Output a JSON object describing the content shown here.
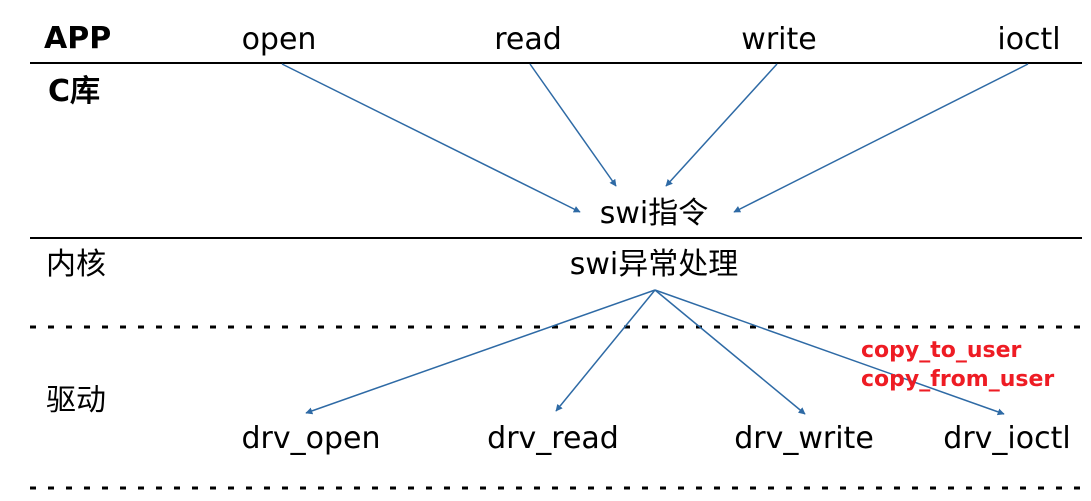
{
  "layers": {
    "app": "APP",
    "c_lib": "C库",
    "kernel": "内核",
    "driver": "驱动"
  },
  "app_calls": [
    "open",
    "read",
    "write",
    "ioctl"
  ],
  "swi_instruction": "swi指令",
  "swi_handler": "swi异常处理",
  "drivers": [
    "drv_open",
    "drv_read",
    "drv_write",
    "drv_ioctl"
  ],
  "copy_notes": [
    "copy_to_user",
    "copy_from_user"
  ],
  "colors": {
    "text": "#000000",
    "arrow": "#2e6aa5",
    "note": "#ee1c24",
    "rule": "#000000"
  }
}
